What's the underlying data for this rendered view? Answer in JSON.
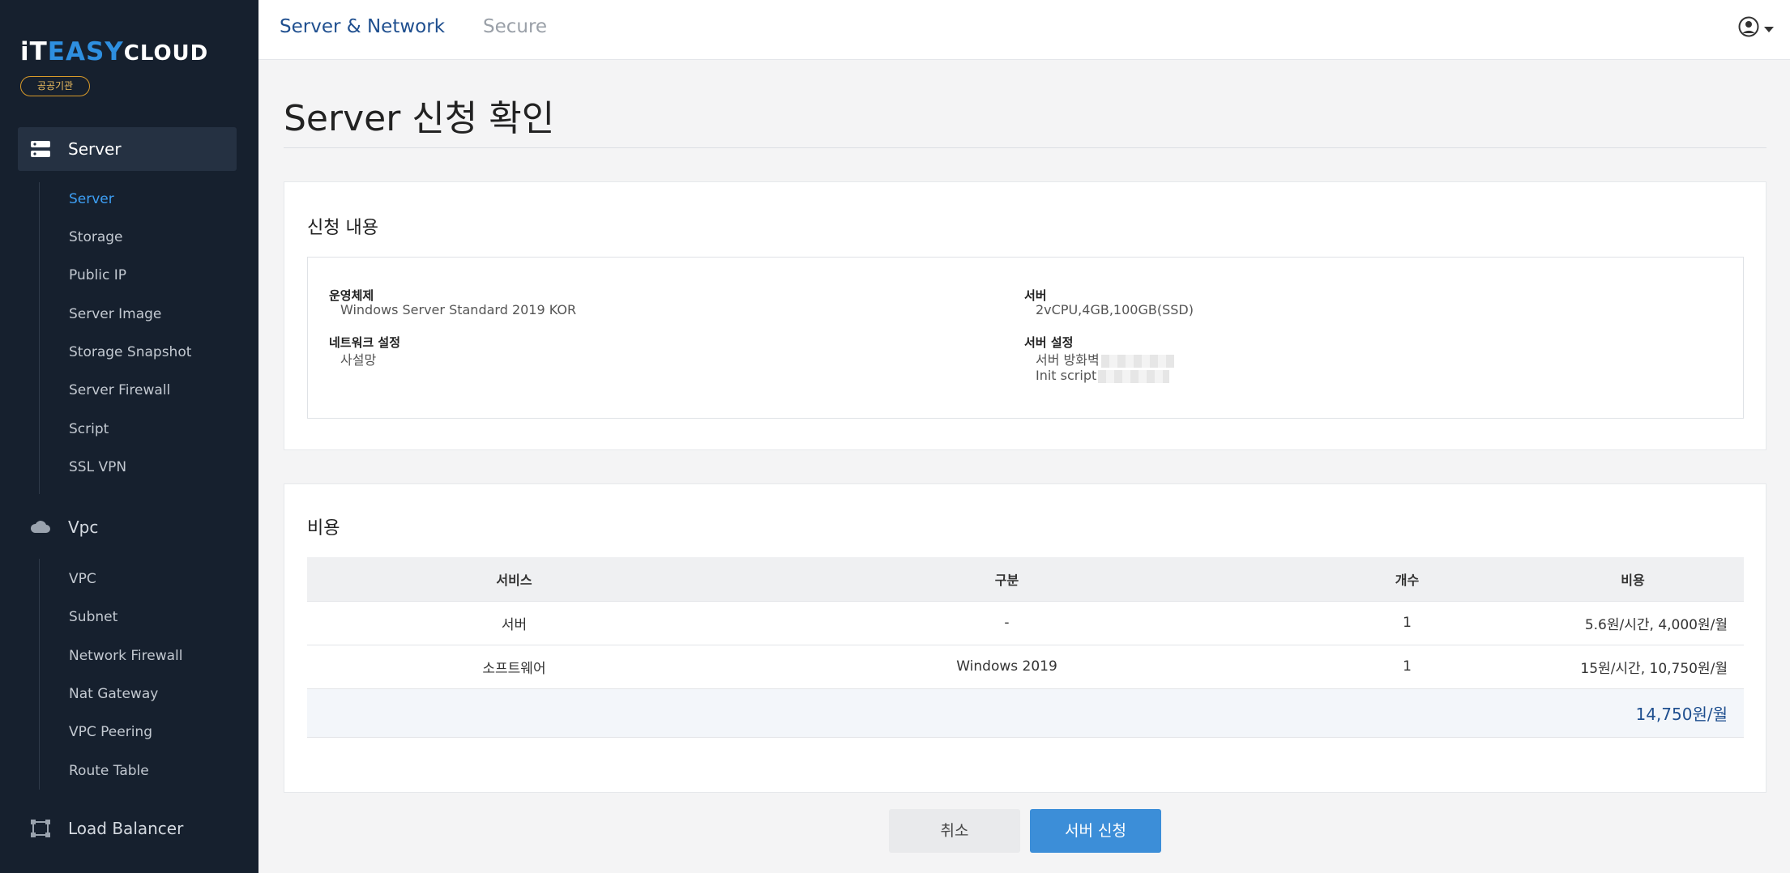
{
  "brand": {
    "part1": "iT",
    "part2": "EASY",
    "part3": "CLOUD",
    "badge": "공공기관"
  },
  "sidebar": {
    "groups": [
      {
        "label": "Server",
        "icon": "server-icon",
        "active": true
      },
      {
        "label": "Vpc",
        "icon": "cloud-icon",
        "active": false
      },
      {
        "label": "Load Balancer",
        "icon": "load-balancer-icon",
        "active": false
      }
    ],
    "server_items": [
      "Server",
      "Storage",
      "Public IP",
      "Server Image",
      "Storage Snapshot",
      "Server Firewall",
      "Script",
      "SSL VPN"
    ],
    "vpc_items": [
      "VPC",
      "Subnet",
      "Network Firewall",
      "Nat Gateway",
      "VPC Peering",
      "Route Table"
    ]
  },
  "topbar": {
    "tab1": "Server & Network",
    "tab2": "Secure",
    "user_icon": "user-circle-icon"
  },
  "page": {
    "title": "Server 신청 확인"
  },
  "request": {
    "title": "신청 내용",
    "os_label": "운영체제",
    "os_value": "Windows Server Standard 2019 KOR",
    "server_label": "서버",
    "server_value": "2vCPU,4GB,100GB(SSD)",
    "network_label": "네트워크 설정",
    "network_value": "사설망",
    "server_settings_label": "서버 설정",
    "firewall_label": "서버 방화벽",
    "init_script_label": "Init script"
  },
  "cost": {
    "title": "비용",
    "headers": [
      "서비스",
      "구분",
      "개수",
      "비용"
    ],
    "rows": [
      [
        "서버",
        "-",
        "1",
        "5.6원/시간, 4,000원/월"
      ],
      [
        "소프트웨어",
        "Windows 2019",
        "1",
        "15원/시간, 10,750원/월"
      ]
    ],
    "total": "14,750원/월"
  },
  "buttons": {
    "cancel": "취소",
    "submit": "서버 신청"
  },
  "colors": {
    "sidebar_bg": "#16202e",
    "accent": "#3c8ed8",
    "active_link": "#3d9ff5",
    "brand_navy": "#1f4f8f",
    "badge": "#d89a2a"
  }
}
